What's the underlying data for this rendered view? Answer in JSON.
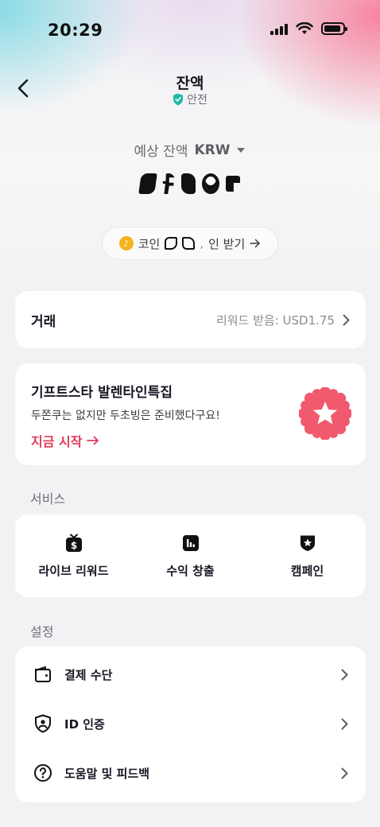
{
  "status": {
    "time": "20:29"
  },
  "header": {
    "title": "잔액",
    "safe_label": "안전"
  },
  "balance": {
    "label": "예상 잔액",
    "currency": "KRW"
  },
  "coins": {
    "prefix": "코인",
    "separator": ",",
    "suffix": "인 받기"
  },
  "trade": {
    "title": "거래",
    "reward_text": "리워드 받음: USD1.75"
  },
  "promo": {
    "title": "기프트스타 발렌타인특집",
    "subtitle": "두쫀쿠는 없지만 두초빙은 준비했다구요!",
    "link": "지금 시작",
    "accent": "#e33a5a",
    "badge_color": "#f15a6e"
  },
  "services": {
    "label": "서비스",
    "items": [
      {
        "label": "라이브 리워드",
        "icon": "dollar-tv-icon"
      },
      {
        "label": "수익 창출",
        "icon": "bar-chart-icon"
      },
      {
        "label": "캠페인",
        "icon": "star-shield-icon"
      }
    ]
  },
  "settings": {
    "label": "설정",
    "items": [
      {
        "label": "결제 수단",
        "icon": "wallet-icon"
      },
      {
        "label": "ID 인증",
        "icon": "id-shield-icon"
      },
      {
        "label": "도움말 및 피드백",
        "icon": "question-icon"
      }
    ]
  }
}
